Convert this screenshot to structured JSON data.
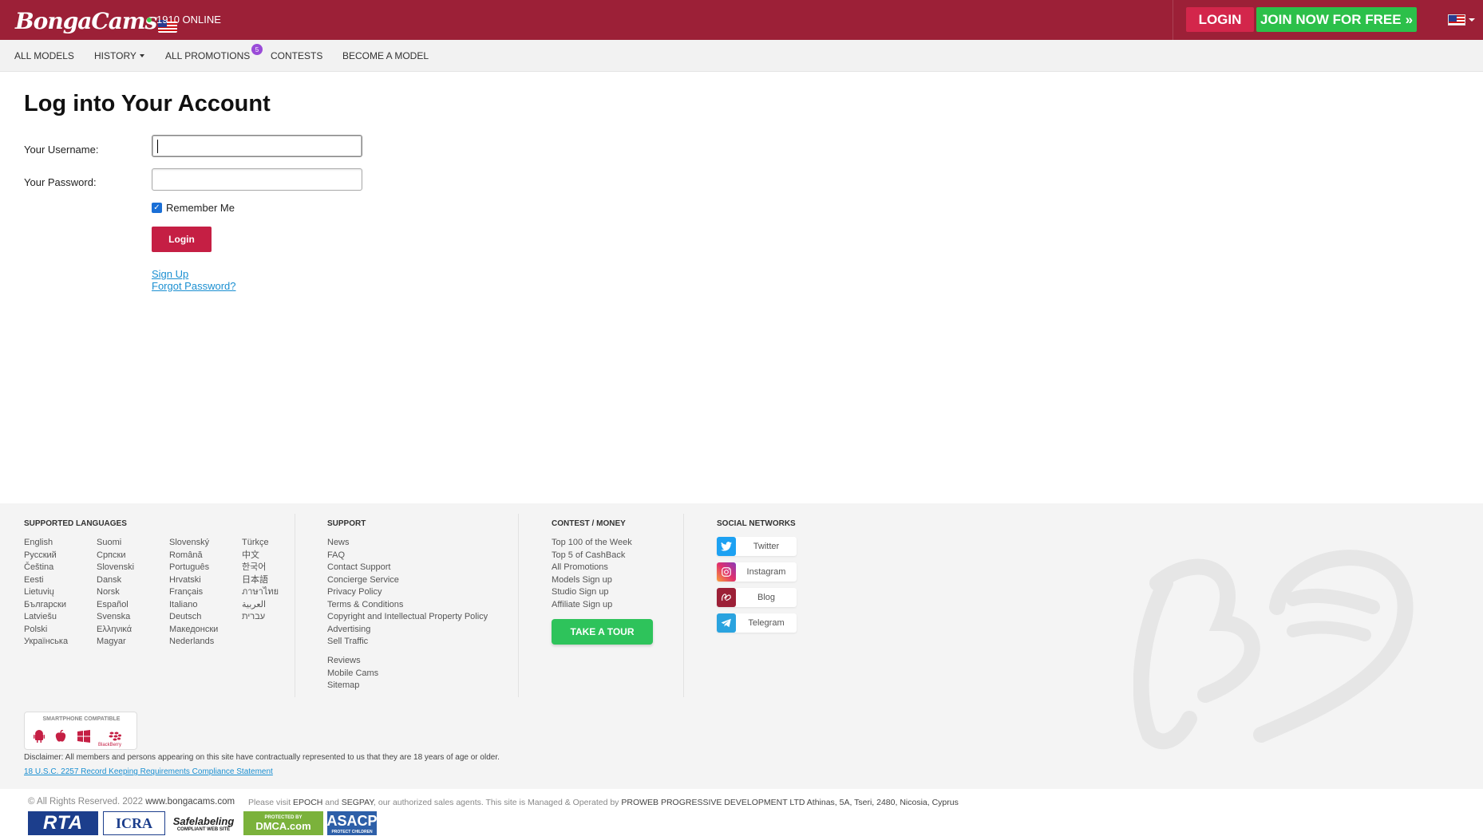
{
  "header": {
    "logo_text": "BongaCams",
    "online_text": "1910 ONLINE",
    "login_label": "LOGIN",
    "join_label": "JOIN NOW FOR FREE",
    "join_arrow": "»"
  },
  "nav": {
    "items": [
      "ALL MODELS",
      "HISTORY",
      "ALL PROMOTIONS",
      "CONTESTS",
      "BECOME A MODEL"
    ],
    "promotions_badge": "5"
  },
  "login": {
    "title": "Log into Your Account",
    "username_label": "Your Username:",
    "password_label": "Your Password:",
    "username_value": "",
    "password_value": "",
    "remember_label": "Remember Me",
    "remember_checked": true,
    "button_label": "Login",
    "signup_link": "Sign Up",
    "forgot_link": "Forgot Password?"
  },
  "footer": {
    "languages_heading": "SUPPORTED LANGUAGES",
    "languages": [
      [
        "English",
        "Русский",
        "Čeština",
        "Eesti",
        "Lietuvių",
        "Български",
        "Latviešu",
        "Polski",
        "Українська"
      ],
      [
        "Suomi",
        "Српски",
        "Slovenski",
        "Dansk",
        "Norsk",
        "Español",
        "Svenska",
        "Ελληνικά",
        "Magyar"
      ],
      [
        "Slovenský",
        "Română",
        "Português",
        "Hrvatski",
        "Français",
        "Italiano",
        "Deutsch",
        "Македонски",
        "Nederlands"
      ],
      [
        "Türkçe",
        "中文",
        "한국어",
        "日本語",
        "ภาษาไทย",
        "العربية",
        "עברית"
      ]
    ],
    "support_heading": "SUPPORT",
    "support_items": [
      "News",
      "FAQ",
      "Contact Support",
      "Concierge Service",
      "Privacy Policy",
      "Terms & Conditions",
      "Copyright and Intellectual Property Policy",
      "Advertising",
      "Sell Traffic"
    ],
    "support_items_2": [
      "Reviews",
      "Mobile Cams",
      "Sitemap"
    ],
    "contest_heading": "CONTEST / MONEY",
    "contest_items": [
      "Top 100 of the Week",
      "Top 5 of CashBack",
      "All Promotions",
      "Models Sign up",
      "Studio Sign up",
      "Affiliate Sign up"
    ],
    "tour_label": "TAKE A TOUR",
    "social_heading": "SOCIAL NETWORKS",
    "social": [
      {
        "label": "Twitter",
        "color": "#1da1f2",
        "icon": "twitter-icon"
      },
      {
        "label": "Instagram",
        "color": "#e1306c",
        "icon": "instagram-icon"
      },
      {
        "label": "Blog",
        "color": "#9c2037",
        "icon": "blog-icon"
      },
      {
        "label": "Telegram",
        "color": "#2aa3df",
        "icon": "telegram-icon"
      }
    ],
    "smartphone_title": "SMARTPHONE COMPATIBLE",
    "blackberry_label": "BlackBerry",
    "disclaimer": "Disclaimer: All members and persons appearing on this site have contractually represented to us that they are 18 years of age or older.",
    "usc_link": "18 U.S.C. 2257 Record Keeping Requirements Compliance Statement"
  },
  "bottom": {
    "copyright": "© All Rights Reserved. 2022",
    "site": "www.bongacams.com",
    "legal_prefix": "Please visit",
    "epoch": "EPOCH",
    "and": "and",
    "segpay": "SEGPAY",
    "legal_mid": ", our authorized sales agents. This site is Managed & Operated by",
    "company": "PROWEB PROGRESSIVE DEVELOPMENT LTD Athinas, 5A, Tseri, 2480, Nicosia, Cyprus",
    "certs": [
      "RTA",
      "ICRA",
      "Safelabeling",
      "DMCA.com",
      "ASACP"
    ],
    "cert_sub": {
      "safelabeling": "COMPLIANT WEB SITE",
      "dmca": "PROTECTED BY",
      "asacp": "PROTECT CHILDREN"
    }
  },
  "colors": {
    "header_bg": "#9c2037",
    "login_btn": "#d3264b",
    "join_btn": "#2cc04a",
    "link": "#1a8fd1",
    "tour_btn": "#2ec35b"
  }
}
